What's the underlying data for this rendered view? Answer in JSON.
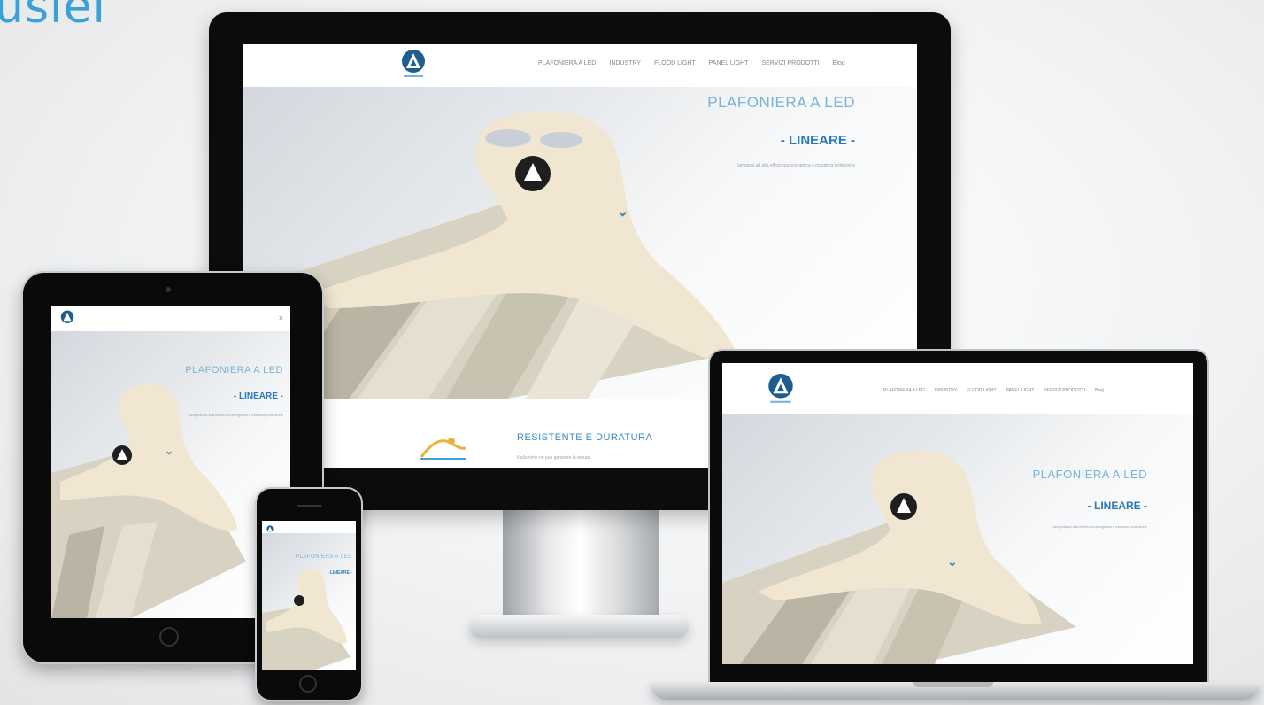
{
  "brand_partial": "usiel",
  "site": {
    "nav": [
      "PLAFONIERA A LED",
      "INDUSTRY",
      "FLOOD LIGHT",
      "PANEL LIGHT",
      "SERVIZI PRODOTTI",
      "Blog"
    ],
    "hero_title": "PLAFONIERA A LED",
    "hero_subtitle": "- LINEARE -",
    "hero_desc": "lampada ad alta efficienza energetica e massima protezione",
    "scroll_icon": "chevron-down-icon",
    "feature_title": "RESISTENTE E DURATURA",
    "feature_desc": "Il alluminio ne puo garantire la tenuta"
  },
  "colors": {
    "accent": "#2a7ab8",
    "title": "#7ab3d6",
    "logo": "#1d5e8f"
  }
}
